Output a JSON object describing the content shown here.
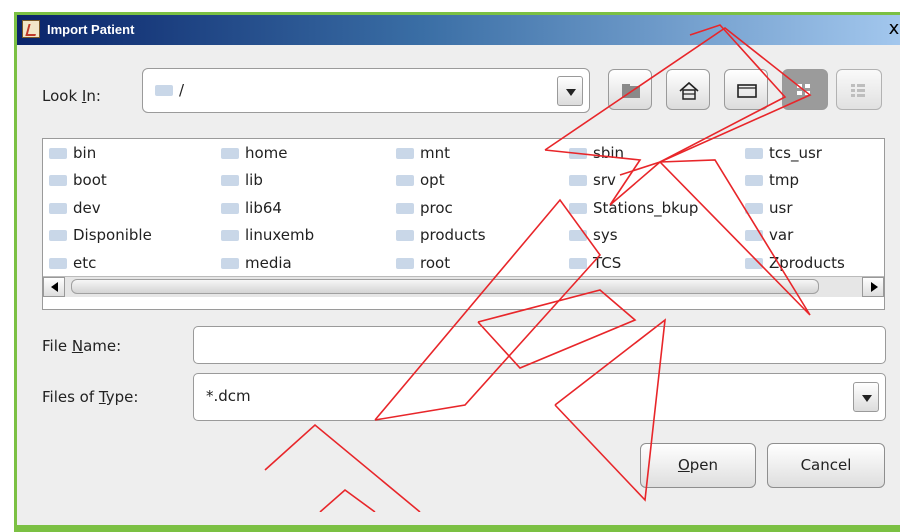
{
  "window": {
    "title": "Import Patient",
    "close_glyph": "x"
  },
  "look_in": {
    "label_pre": "Look ",
    "label_mn": "I",
    "label_post": "n:",
    "value": "/"
  },
  "files": [
    {
      "name": "bin"
    },
    {
      "name": "boot"
    },
    {
      "name": "dev"
    },
    {
      "name": "Disponible"
    },
    {
      "name": "etc"
    },
    {
      "name": "home"
    },
    {
      "name": "lib"
    },
    {
      "name": "lib64"
    },
    {
      "name": "linuxemb"
    },
    {
      "name": "media"
    },
    {
      "name": "mnt"
    },
    {
      "name": "opt"
    },
    {
      "name": "proc"
    },
    {
      "name": "products"
    },
    {
      "name": "root"
    },
    {
      "name": "sbin"
    },
    {
      "name": "srv"
    },
    {
      "name": "Stations_bkup"
    },
    {
      "name": "sys"
    },
    {
      "name": "TCS"
    },
    {
      "name": "tcs_usr"
    },
    {
      "name": "tmp"
    },
    {
      "name": "usr"
    },
    {
      "name": "var"
    },
    {
      "name": "Zproducts"
    }
  ],
  "file_name": {
    "label_pre": "File ",
    "label_mn": "N",
    "label_post": "ame:",
    "value": ""
  },
  "files_of_type": {
    "label_pre": "Files of ",
    "label_mn": "T",
    "label_post": "ype:",
    "value": "*.dcm"
  },
  "buttons": {
    "open_mn": "O",
    "open_rest": "pen",
    "cancel": "Cancel"
  },
  "colors": {
    "frame": "#7bc043",
    "titlebar": "#0a246a",
    "watermark": "#e8262a"
  }
}
